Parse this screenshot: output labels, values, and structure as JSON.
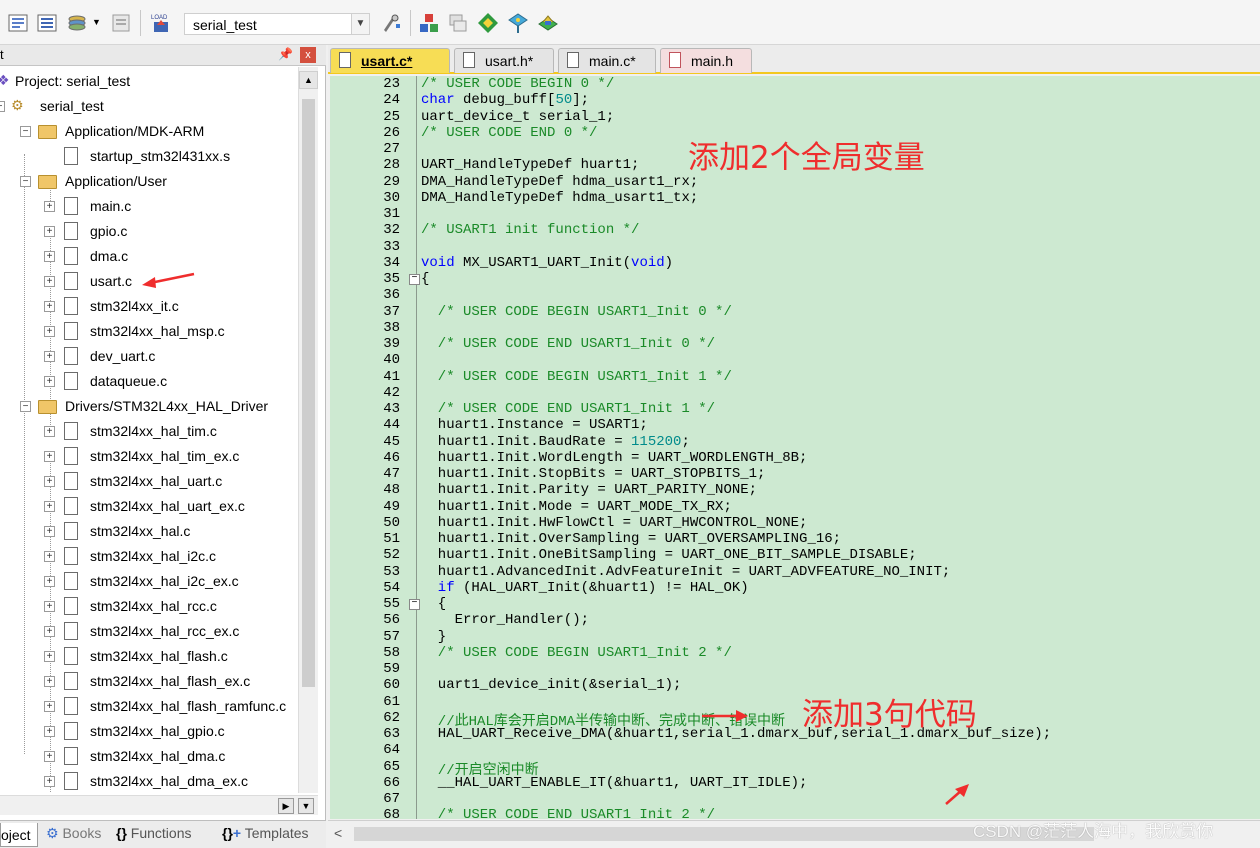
{
  "toolbar": {
    "target_name": "serial_test",
    "buttons": [
      "translate-icon",
      "build-icon",
      "rebuild-icon",
      "batch-build-icon",
      "load-icon",
      "options-icon",
      "manage-components-icon",
      "pack-installer-icon",
      "select-packs-icon",
      "event-recorder-icon"
    ],
    "load_label": "LOAD"
  },
  "project_panel": {
    "title": "t",
    "pin": "↑",
    "close": "x",
    "tree": [
      {
        "label": "Project: serial_test",
        "level": 0,
        "type": "project"
      },
      {
        "label": "serial_test",
        "level": 0,
        "type": "target"
      },
      {
        "label": "Application/MDK-ARM",
        "level": 1,
        "type": "folder"
      },
      {
        "label": "startup_stm32l431xx.s",
        "level": 2,
        "type": "file",
        "expand": false
      },
      {
        "label": "Application/User",
        "level": 1,
        "type": "folder"
      },
      {
        "label": "main.c",
        "level": 2,
        "type": "file",
        "expand": true
      },
      {
        "label": "gpio.c",
        "level": 2,
        "type": "file",
        "expand": true
      },
      {
        "label": "dma.c",
        "level": 2,
        "type": "file",
        "expand": true
      },
      {
        "label": "usart.c",
        "level": 2,
        "type": "file",
        "expand": true
      },
      {
        "label": "stm32l4xx_it.c",
        "level": 2,
        "type": "file",
        "expand": true
      },
      {
        "label": "stm32l4xx_hal_msp.c",
        "level": 2,
        "type": "file",
        "expand": true
      },
      {
        "label": "dev_uart.c",
        "level": 2,
        "type": "file",
        "expand": true
      },
      {
        "label": "dataqueue.c",
        "level": 2,
        "type": "file",
        "expand": true
      },
      {
        "label": "Drivers/STM32L4xx_HAL_Driver",
        "level": 1,
        "type": "folder"
      },
      {
        "label": "stm32l4xx_hal_tim.c",
        "level": 2,
        "type": "file",
        "expand": true
      },
      {
        "label": "stm32l4xx_hal_tim_ex.c",
        "level": 2,
        "type": "file",
        "expand": true
      },
      {
        "label": "stm32l4xx_hal_uart.c",
        "level": 2,
        "type": "file",
        "expand": true
      },
      {
        "label": "stm32l4xx_hal_uart_ex.c",
        "level": 2,
        "type": "file",
        "expand": true
      },
      {
        "label": "stm32l4xx_hal.c",
        "level": 2,
        "type": "file",
        "expand": true
      },
      {
        "label": "stm32l4xx_hal_i2c.c",
        "level": 2,
        "type": "file",
        "expand": true
      },
      {
        "label": "stm32l4xx_hal_i2c_ex.c",
        "level": 2,
        "type": "file",
        "expand": true
      },
      {
        "label": "stm32l4xx_hal_rcc.c",
        "level": 2,
        "type": "file",
        "expand": true
      },
      {
        "label": "stm32l4xx_hal_rcc_ex.c",
        "level": 2,
        "type": "file",
        "expand": true
      },
      {
        "label": "stm32l4xx_hal_flash.c",
        "level": 2,
        "type": "file",
        "expand": true
      },
      {
        "label": "stm32l4xx_hal_flash_ex.c",
        "level": 2,
        "type": "file",
        "expand": true
      },
      {
        "label": "stm32l4xx_hal_flash_ramfunc.c",
        "level": 2,
        "type": "file",
        "expand": true
      },
      {
        "label": "stm32l4xx_hal_gpio.c",
        "level": 2,
        "type": "file",
        "expand": true
      },
      {
        "label": "stm32l4xx_hal_dma.c",
        "level": 2,
        "type": "file",
        "expand": true
      },
      {
        "label": "stm32l4xx_hal_dma_ex.c",
        "level": 2,
        "type": "file",
        "expand": true
      }
    ],
    "bottom_tabs": [
      {
        "label": "oject",
        "active": true
      },
      {
        "label": "Books",
        "active": false
      },
      {
        "label": "Functions",
        "active": false
      },
      {
        "label": "Templates",
        "active": false
      }
    ]
  },
  "editor": {
    "tabs": [
      {
        "label": "usart.c*",
        "active": true
      },
      {
        "label": "usart.h*",
        "active": false
      },
      {
        "label": "main.c*",
        "active": false
      },
      {
        "label": "main.h",
        "active": false
      }
    ],
    "lines": [
      {
        "n": "23",
        "indent": 0,
        "text": "/* USER CODE BEGIN 0 */",
        "kind": "comment"
      },
      {
        "n": "24",
        "indent": 0,
        "text": "char debug_buff[50];",
        "kind": "char"
      },
      {
        "n": "25",
        "indent": 0,
        "text": "uart_device_t serial_1;",
        "kind": "plain"
      },
      {
        "n": "26",
        "indent": 0,
        "text": "/* USER CODE END 0 */",
        "kind": "comment"
      },
      {
        "n": "27",
        "indent": 0,
        "text": "",
        "kind": "plain"
      },
      {
        "n": "28",
        "indent": 0,
        "text": "UART_HandleTypeDef huart1;",
        "kind": "plain"
      },
      {
        "n": "29",
        "indent": 0,
        "text": "DMA_HandleTypeDef hdma_usart1_rx;",
        "kind": "plain"
      },
      {
        "n": "30",
        "indent": 0,
        "text": "DMA_HandleTypeDef hdma_usart1_tx;",
        "kind": "plain"
      },
      {
        "n": "31",
        "indent": 0,
        "text": "",
        "kind": "plain"
      },
      {
        "n": "32",
        "indent": 0,
        "text": "/* USART1 init function */",
        "kind": "comment"
      },
      {
        "n": "33",
        "indent": 0,
        "text": "",
        "kind": "plain"
      },
      {
        "n": "34",
        "indent": 0,
        "text": "void MX_USART1_UART_Init(void)",
        "kind": "void"
      },
      {
        "n": "35",
        "indent": 0,
        "text": "{",
        "kind": "plain",
        "fold": true
      },
      {
        "n": "36",
        "indent": 0,
        "text": "",
        "kind": "plain"
      },
      {
        "n": "37",
        "indent": 2,
        "text": "/* USER CODE BEGIN USART1_Init 0 */",
        "kind": "comment"
      },
      {
        "n": "38",
        "indent": 0,
        "text": "",
        "kind": "plain"
      },
      {
        "n": "39",
        "indent": 2,
        "text": "/* USER CODE END USART1_Init 0 */",
        "kind": "comment"
      },
      {
        "n": "40",
        "indent": 0,
        "text": "",
        "kind": "plain"
      },
      {
        "n": "41",
        "indent": 2,
        "text": "/* USER CODE BEGIN USART1_Init 1 */",
        "kind": "comment"
      },
      {
        "n": "42",
        "indent": 0,
        "text": "",
        "kind": "plain"
      },
      {
        "n": "43",
        "indent": 2,
        "text": "/* USER CODE END USART1_Init 1 */",
        "kind": "comment"
      },
      {
        "n": "44",
        "indent": 2,
        "text": "huart1.Instance = USART1;",
        "kind": "plain"
      },
      {
        "n": "45",
        "indent": 2,
        "text": "huart1.Init.BaudRate = 115200;",
        "kind": "baud"
      },
      {
        "n": "46",
        "indent": 2,
        "text": "huart1.Init.WordLength = UART_WORDLENGTH_8B;",
        "kind": "plain"
      },
      {
        "n": "47",
        "indent": 2,
        "text": "huart1.Init.StopBits = UART_STOPBITS_1;",
        "kind": "plain"
      },
      {
        "n": "48",
        "indent": 2,
        "text": "huart1.Init.Parity = UART_PARITY_NONE;",
        "kind": "plain"
      },
      {
        "n": "49",
        "indent": 2,
        "text": "huart1.Init.Mode = UART_MODE_TX_RX;",
        "kind": "plain"
      },
      {
        "n": "50",
        "indent": 2,
        "text": "huart1.Init.HwFlowCtl = UART_HWCONTROL_NONE;",
        "kind": "plain"
      },
      {
        "n": "51",
        "indent": 2,
        "text": "huart1.Init.OverSampling = UART_OVERSAMPLING_16;",
        "kind": "plain"
      },
      {
        "n": "52",
        "indent": 2,
        "text": "huart1.Init.OneBitSampling = UART_ONE_BIT_SAMPLE_DISABLE;",
        "kind": "plain"
      },
      {
        "n": "53",
        "indent": 2,
        "text": "huart1.AdvancedInit.AdvFeatureInit = UART_ADVFEATURE_NO_INIT;",
        "kind": "plain"
      },
      {
        "n": "54",
        "indent": 2,
        "text": "if (HAL_UART_Init(&huart1) != HAL_OK)",
        "kind": "if"
      },
      {
        "n": "55",
        "indent": 2,
        "text": "{",
        "kind": "plain",
        "fold": true
      },
      {
        "n": "56",
        "indent": 4,
        "text": "Error_Handler();",
        "kind": "plain"
      },
      {
        "n": "57",
        "indent": 2,
        "text": "}",
        "kind": "plain"
      },
      {
        "n": "58",
        "indent": 2,
        "text": "/* USER CODE BEGIN USART1_Init 2 */",
        "kind": "comment"
      },
      {
        "n": "59",
        "indent": 0,
        "text": "",
        "kind": "plain"
      },
      {
        "n": "60",
        "indent": 2,
        "text": "uart1_device_init(&serial_1);",
        "kind": "plain"
      },
      {
        "n": "61",
        "indent": 0,
        "text": "",
        "kind": "plain"
      },
      {
        "n": "62",
        "indent": 2,
        "text": "//此HAL库会开启DMA半传输中断、完成中断、错误中断",
        "kind": "comment"
      },
      {
        "n": "63",
        "indent": 2,
        "text": "HAL_UART_Receive_DMA(&huart1,serial_1.dmarx_buf,serial_1.dmarx_buf_size);",
        "kind": "plain"
      },
      {
        "n": "64",
        "indent": 0,
        "text": "",
        "kind": "plain"
      },
      {
        "n": "65",
        "indent": 2,
        "text": "//开启空闲中断",
        "kind": "comment"
      },
      {
        "n": "66",
        "indent": 2,
        "text": "__HAL_UART_ENABLE_IT(&huart1, UART_IT_IDLE);",
        "kind": "plain"
      },
      {
        "n": "67",
        "indent": 0,
        "text": "",
        "kind": "plain"
      },
      {
        "n": "68",
        "indent": 2,
        "text": "/* USER CODE END USART1_Init 2 */",
        "kind": "comment"
      }
    ],
    "annotations": {
      "note1": "添加2个全局变量",
      "note2": "添加3句代码"
    },
    "hscroll_left": "<"
  },
  "watermark": "CSDN @茫茫人海中，我欣赏你",
  "colors": {
    "code_bg": "#cde9d1",
    "comment": "#1a8a28",
    "keyword": "#0000ff",
    "number": "#008b8b",
    "annotation": "#ef2d2d",
    "active_tab": "#f7dd55"
  }
}
